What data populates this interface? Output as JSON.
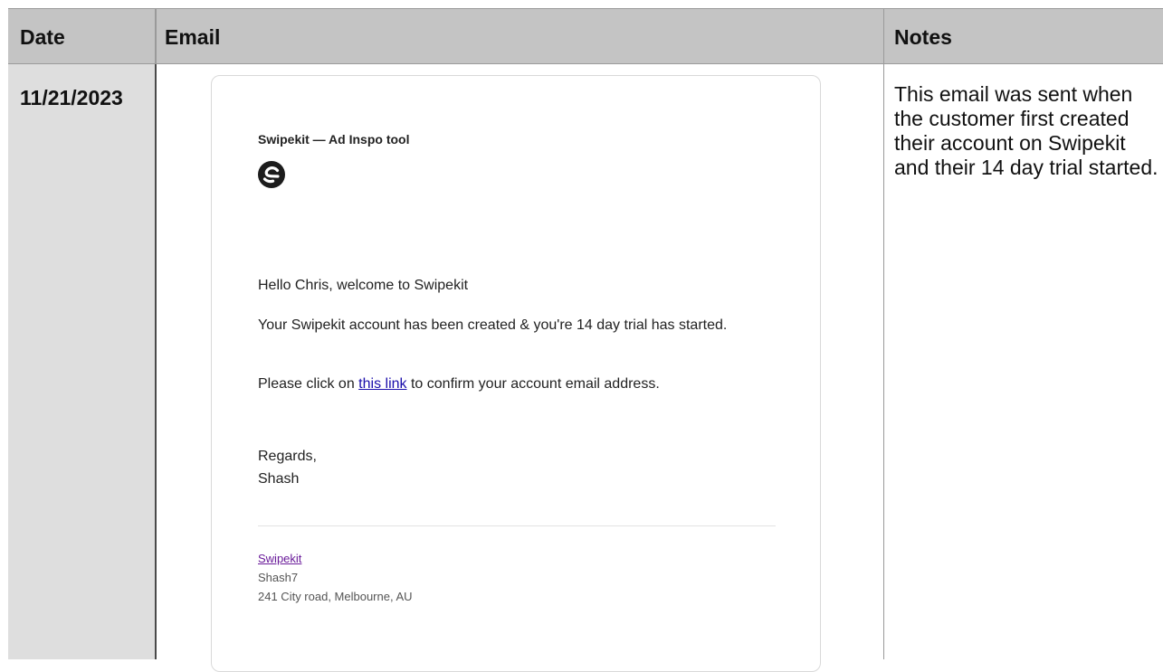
{
  "table": {
    "headers": {
      "date": "Date",
      "email": "Email",
      "notes": "Notes"
    },
    "row": {
      "date": "11/21/2023",
      "notes": "This email was sent when the customer first created their account on Swipekit and their 14 day trial started."
    }
  },
  "email": {
    "sender_name": "Swipekit — Ad Inspo tool",
    "logo_icon": "swipekit-logo-icon",
    "greeting": "Hello Chris, welcome to Swipekit",
    "body_line_1": "Your Swipekit account has been created & you're 14 day trial has started.",
    "body_line_2_pre": "Please click on ",
    "body_link": "this link",
    "body_line_2_post": " to confirm your account email address.",
    "signoff": "Regards,",
    "signature": "Shash",
    "footer": {
      "company_link": "Swipekit",
      "company_name": "Shash7",
      "address": "241 City road, Melbourne, AU"
    }
  },
  "colors": {
    "header_bg": "#c4c4c4",
    "date_col_bg": "#dedede",
    "link_blue": "#1a0dab",
    "footer_link": "#6a1b9a"
  }
}
